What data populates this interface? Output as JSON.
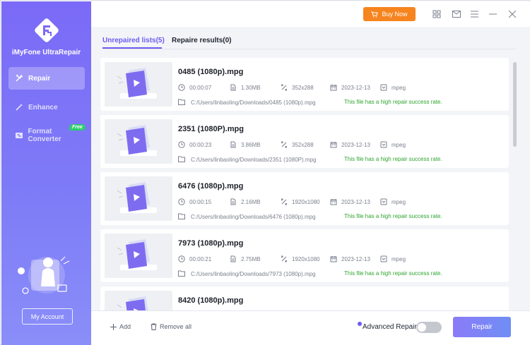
{
  "app": {
    "name": "iMyFone UltraRepair"
  },
  "sidebar": {
    "items": [
      {
        "label": "Repair",
        "icon": "tools-icon",
        "active": true
      },
      {
        "label": "Enhance",
        "icon": "magic-wand-icon",
        "active": false
      },
      {
        "label": "Format Converter",
        "icon": "converter-icon",
        "active": false,
        "badge": "Free"
      }
    ],
    "account_label": "My Account"
  },
  "topbar": {
    "buy_label": "Buy Now",
    "icons": [
      "grid-icon",
      "mail-icon",
      "menu-icon",
      "minimize-icon",
      "close-icon"
    ]
  },
  "tabs": [
    {
      "label": "Unrepaired lists(5)",
      "active": true
    },
    {
      "label": "Repaire results(0)",
      "active": false
    }
  ],
  "files": [
    {
      "name": "0485 (1080p).mpg",
      "duration": "00:00:07",
      "size": "1.30MB",
      "resolution": "352x288",
      "date": "2023-12-13",
      "format": "mpeg",
      "path": "C:/Users/linbaoling/Downloads/0485 (1080p).mpg",
      "status": "This file has a high repair success rate."
    },
    {
      "name": "2351 (1080P).mpg",
      "duration": "00:00:23",
      "size": "3.86MB",
      "resolution": "352x288",
      "date": "2023-12-13",
      "format": "mpeg",
      "path": "C:/Users/linbaoling/Downloads/2351 (1080P).mpg",
      "status": "This file has a high repair success rate."
    },
    {
      "name": "6476 (1080p).mpg",
      "duration": "00:00:15",
      "size": "2.16MB",
      "resolution": "1920x1080",
      "date": "2023-12-13",
      "format": "mpeg",
      "path": "C:/Users/linbaoling/Downloads/6476 (1080p).mpg",
      "status": "This file has a high repair success rate."
    },
    {
      "name": "7973 (1080p).mpg",
      "duration": "00:00:21",
      "size": "2.75MB",
      "resolution": "1920x1080",
      "date": "2023-12-13",
      "format": "mpeg",
      "path": "C:/Users/linbaoling/Downloads/7973 (1080p).mpg",
      "status": "This file has a high repair success rate."
    },
    {
      "name": "8420 (1080p).mpg"
    }
  ],
  "bottom": {
    "add_label": "Add",
    "remove_label": "Remove all",
    "advanced_label": "Advanced Repair",
    "advanced_enabled": false,
    "repair_label": "Repair"
  },
  "colors": {
    "accent": "#6b5cf0",
    "buy": "#f6841f",
    "success": "#2fa52f",
    "sidebar": "#7b6af7"
  }
}
